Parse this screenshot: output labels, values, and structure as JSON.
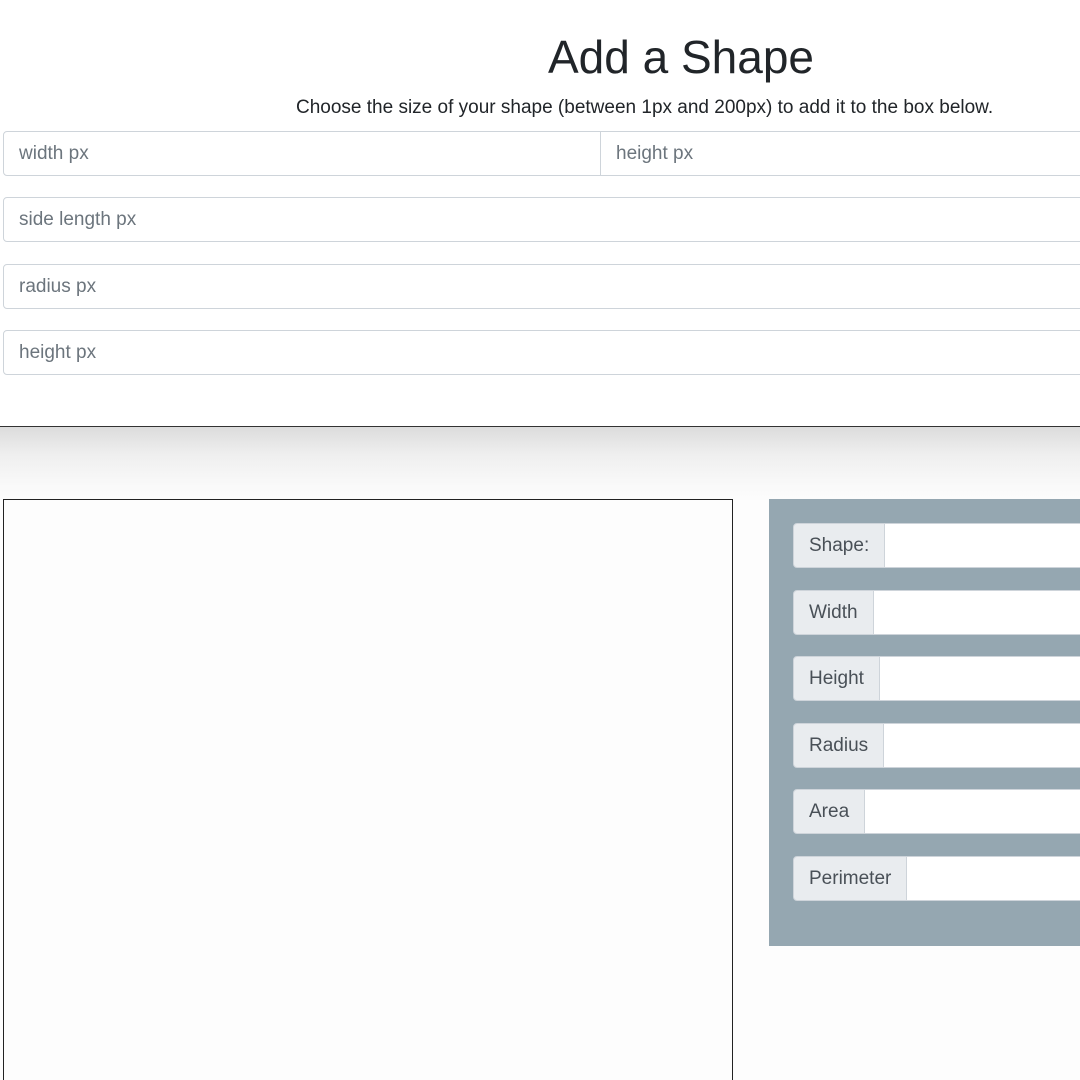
{
  "header": {
    "title": "Add a Shape",
    "subtitle": "Choose the size of your shape (between 1px and 200px) to add it to the box below."
  },
  "inputs": {
    "rectangle": {
      "width_placeholder": "width px",
      "height_placeholder": "height px"
    },
    "square": {
      "side_placeholder": "side length px"
    },
    "circle": {
      "radius_placeholder": "radius px"
    },
    "triangle": {
      "height_placeholder": "height px"
    }
  },
  "info_panel": {
    "rows": [
      {
        "label": "Shape:",
        "value": ""
      },
      {
        "label": "Width",
        "value": ""
      },
      {
        "label": "Height",
        "value": ""
      },
      {
        "label": "Radius",
        "value": ""
      },
      {
        "label": "Area",
        "value": ""
      },
      {
        "label": "Perimeter",
        "value": ""
      }
    ]
  },
  "colors": {
    "panel_background": "#95a7b1",
    "label_background": "#e9ecef",
    "input_border": "#ced4da",
    "text": "#212529"
  }
}
